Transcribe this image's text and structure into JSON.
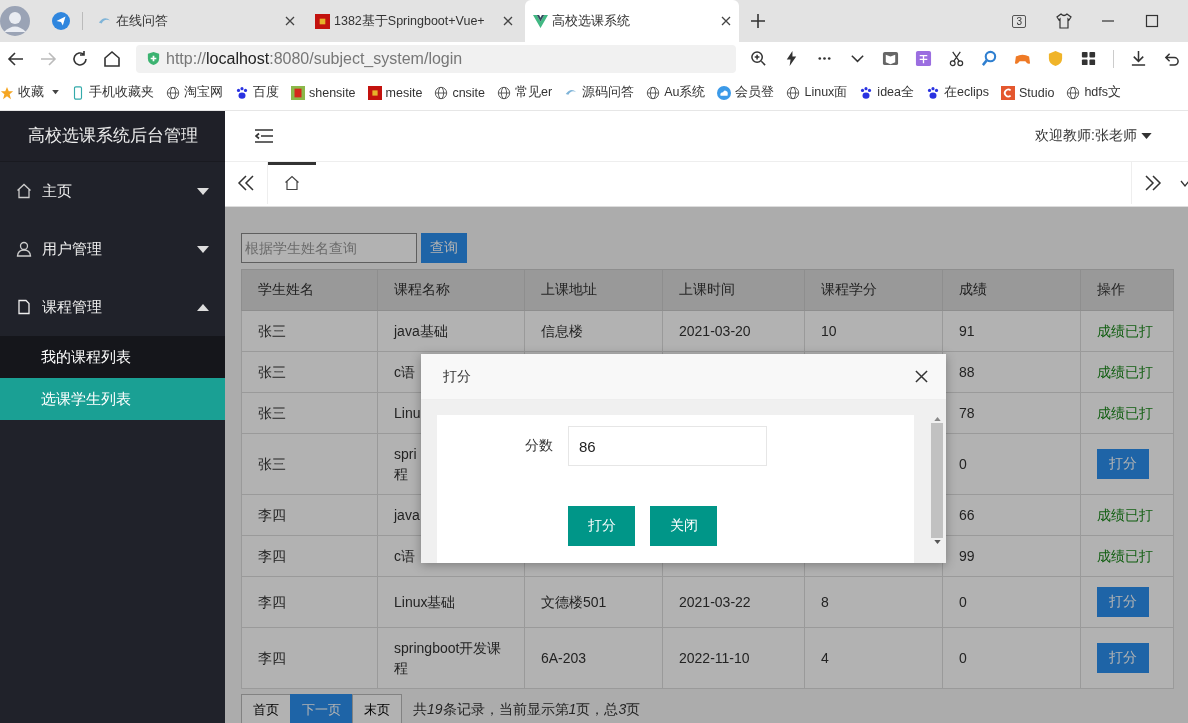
{
  "browser": {
    "tabs": [
      {
        "title": "在线问答",
        "kind": "wave",
        "selected": false
      },
      {
        "title": "1382基于Springboot+Vue+",
        "kind": "red",
        "selected": false
      },
      {
        "title": "高校选课系统",
        "kind": "vue",
        "selected": true
      }
    ],
    "tab_count": "3",
    "url": [
      {
        "text": "http://",
        "kind": "dim"
      },
      {
        "text": "localhost",
        "kind": "host"
      },
      {
        "text": ":8080/subject_system/login",
        "kind": "dim"
      }
    ],
    "bookmarks": [
      {
        "label": "收藏",
        "kind": "star"
      },
      {
        "label": "手机收藏夹",
        "kind": "phone"
      },
      {
        "label": "淘宝网",
        "kind": "globe"
      },
      {
        "label": "百度",
        "kind": "paw"
      },
      {
        "label": "shensite",
        "kind": "shen"
      },
      {
        "label": "mesite",
        "kind": "redbox"
      },
      {
        "label": "cnsite",
        "kind": "globe"
      },
      {
        "label": "常见er",
        "kind": "globe"
      },
      {
        "label": "源码问答",
        "kind": "wave"
      },
      {
        "label": "Au系统",
        "kind": "globe"
      },
      {
        "label": "会员登",
        "kind": "cloud"
      },
      {
        "label": "Linux面",
        "kind": "globe"
      },
      {
        "label": "idea全",
        "kind": "paw"
      },
      {
        "label": "在eclips",
        "kind": "paw"
      },
      {
        "label": "Studio",
        "kind": "c"
      },
      {
        "label": "hdfs文",
        "kind": "globe"
      }
    ]
  },
  "app": {
    "title": "高校选课系统后台管理",
    "menu": [
      {
        "label": "主页",
        "kind": "home",
        "expanded": false
      },
      {
        "label": "用户管理",
        "kind": "user",
        "expanded": false
      },
      {
        "label": "课程管理",
        "kind": "file",
        "expanded": true,
        "children": [
          {
            "label": "我的课程列表",
            "selected": false
          },
          {
            "label": "选课学生列表",
            "selected": true
          }
        ]
      }
    ],
    "welcome": "欢迎教师:张老师"
  },
  "search": {
    "placeholder": "根据学生姓名查询",
    "button": "查询"
  },
  "table": {
    "columns": [
      "学生姓名",
      "课程名称",
      "上课地址",
      "上课时间",
      "课程学分",
      "成绩",
      "操作"
    ],
    "rows": [
      {
        "name": "张三",
        "course": "java基础",
        "address": "信息楼",
        "time": "2021-03-20",
        "credit": "10",
        "score": "91",
        "action": {
          "kind": "done",
          "text": "成绩已打"
        }
      },
      {
        "name": "张三",
        "course": "c语",
        "score": "88",
        "action": {
          "kind": "done",
          "text": "成绩已打"
        }
      },
      {
        "name": "张三",
        "course": "Linu",
        "score": "78",
        "action": {
          "kind": "done",
          "text": "成绩已打"
        }
      },
      {
        "name": "张三",
        "course": "spri\n程",
        "score": "0",
        "action": {
          "kind": "button",
          "text": "打分"
        }
      },
      {
        "name": "李四",
        "course": "java",
        "score": "66",
        "action": {
          "kind": "done",
          "text": "成绩已打"
        }
      },
      {
        "name": "李四",
        "course": "c语",
        "score": "99",
        "action": {
          "kind": "done",
          "text": "成绩已打"
        }
      },
      {
        "name": "李四",
        "course": "Linux基础",
        "address": "文德楼501",
        "time": "2021-03-22",
        "credit": "8",
        "score": "0",
        "action": {
          "kind": "button",
          "text": "打分"
        }
      },
      {
        "name": "李四",
        "course": "springboot开发课程",
        "address": "6A-203",
        "time": "2022-11-10",
        "credit": "4",
        "score": "0",
        "action": {
          "kind": "button",
          "text": "打分"
        }
      }
    ]
  },
  "pagination": {
    "buttons": [
      {
        "label": "首页",
        "selected": false
      },
      {
        "label": "下一页",
        "selected": true
      },
      {
        "label": "末页",
        "selected": false
      }
    ],
    "summary": [
      {
        "text": "共",
        "italic": false
      },
      {
        "text": "19",
        "italic": true
      },
      {
        "text": "条记录，当前显示第",
        "italic": false
      },
      {
        "text": "1",
        "italic": true
      },
      {
        "text": "页，总",
        "italic": false
      },
      {
        "text": "3",
        "italic": true
      },
      {
        "text": "页",
        "italic": false
      }
    ]
  },
  "dialog": {
    "title": "打分",
    "field": {
      "label": "分数",
      "value": "86"
    },
    "buttons": [
      "打分",
      "关闭"
    ]
  }
}
